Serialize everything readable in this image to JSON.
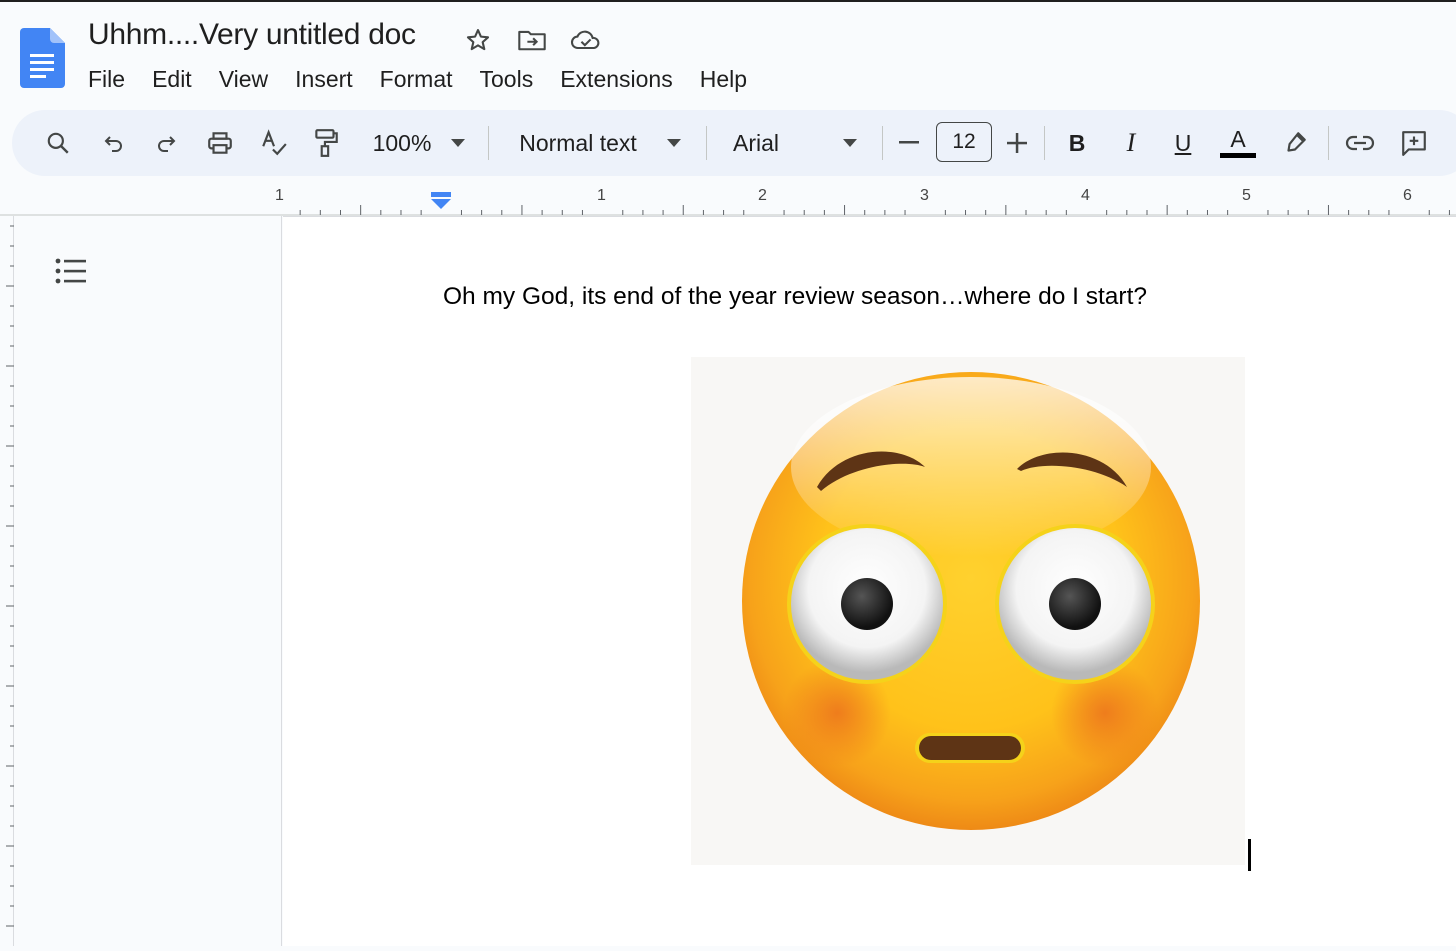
{
  "app": {
    "title": "Uhhm....Very untitled doc"
  },
  "menubar": [
    "File",
    "Edit",
    "View",
    "Insert",
    "Format",
    "Tools",
    "Extensions",
    "Help"
  ],
  "toolbar": {
    "zoom": "100%",
    "style": "Normal text",
    "font": "Arial",
    "font_size": "12",
    "bold": "B",
    "italic": "I",
    "underline": "U",
    "text_color_glyph": "A",
    "minus": "−",
    "plus": "+"
  },
  "ruler": {
    "labels": [
      "1",
      "1",
      "2",
      "3",
      "4",
      "5",
      "6"
    ]
  },
  "document": {
    "text": "Oh my God, its end of the year review season…where do I start?",
    "image": "flushed-face-emoji"
  },
  "colors": {
    "accent": "#4285f4",
    "toolbar_bg": "#edf2fa",
    "page_bg": "#f9fbfd"
  }
}
